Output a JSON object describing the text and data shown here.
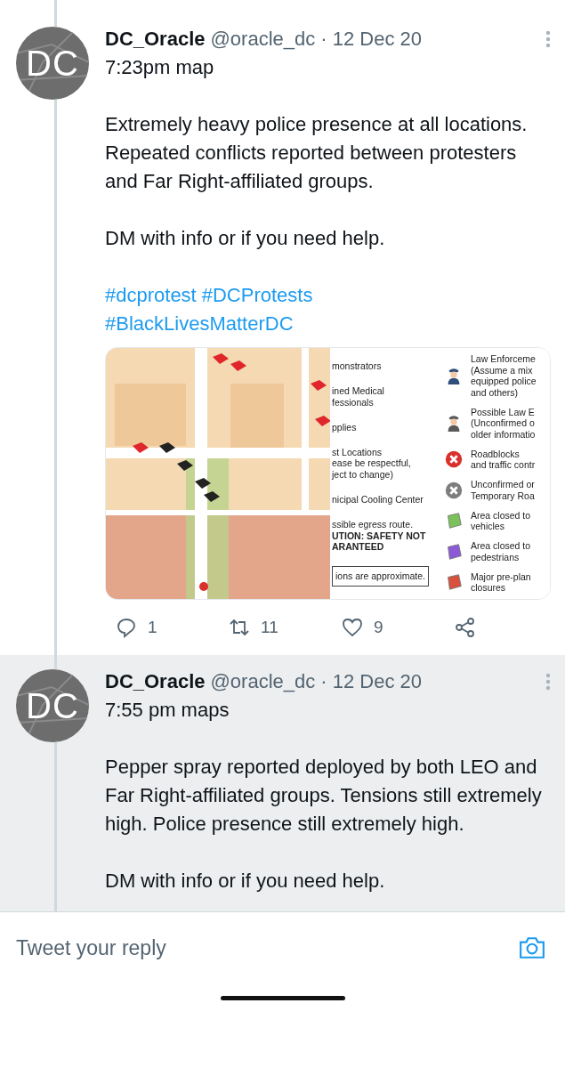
{
  "tweets": [
    {
      "highlighted": false,
      "avatar": "DC",
      "name": "DC_Oracle",
      "handle": "@oracle_dc",
      "date": "· 12 Dec 20",
      "subtitle": "7:23pm map",
      "paragraphs": [
        "Extremely heavy police presence at all locations. Repeated conflicts reported between protesters and Far Right-affiliated groups.",
        "DM with info or if you need help."
      ],
      "hashtags": [
        "#dcprotest",
        "#DCProtests",
        "#BlackLivesMatterDC"
      ],
      "media": {
        "kind": "picture",
        "legend_left": [
          {
            "kind": "plain",
            "text": "monstrators"
          },
          {
            "kind": "plain",
            "text": "ined Medical\nfessionals"
          },
          {
            "kind": "plain",
            "text": "pplies"
          },
          {
            "kind": "plain",
            "text": "st Locations\nease be respectful,\nject to change)"
          },
          {
            "kind": "plain",
            "text": "nicipal Cooling Center"
          },
          {
            "kind": "plain",
            "text": "ssible egress route.\n**UTION: SAFETY NOT\nARANTEED**"
          },
          {
            "kind": "boxed",
            "text": "ions are approximate."
          }
        ],
        "legend_right": [
          {
            "kind": "officer",
            "color": "#2f4f78",
            "text": "Law Enforceme\n(Assume a mix\nequipped police\nand others)"
          },
          {
            "kind": "officer",
            "color": "#5a5a5a",
            "text": "Possible Law E\n(Unconfirmed o\nolder informatio"
          },
          {
            "kind": "cross",
            "color": "#d9302c",
            "text": "Roadblocks\nand traffic contr"
          },
          {
            "kind": "cross",
            "color": "#7d7d7d",
            "text": "Unconfirmed or\nTemporary Roa"
          },
          {
            "kind": "area",
            "color": "#7cc25a",
            "text": "Area closed to\nvehicles"
          },
          {
            "kind": "area",
            "color": "#8a5ad8",
            "text": "Area closed to\npedestrians"
          },
          {
            "kind": "area",
            "color": "#d9503c",
            "text": "Major pre-plan\nclosures"
          }
        ]
      },
      "actions": [
        {
          "kind": "reply",
          "count": "1"
        },
        {
          "kind": "retweet",
          "count": "11"
        },
        {
          "kind": "like",
          "count": "9"
        },
        {
          "kind": "share"
        }
      ]
    },
    {
      "highlighted": true,
      "avatar": "DC",
      "name": "DC_Oracle",
      "handle": "@oracle_dc",
      "date": "· 12 Dec 20",
      "subtitle": "7:55 pm maps",
      "paragraphs": [
        "Pepper spray reported deployed by both LEO and Far Right-affiliated groups. Tensions still extremely high. Police presence still extremely high.",
        "DM with info or if you need help."
      ]
    }
  ],
  "reply": {
    "placeholder": "Tweet your reply"
  }
}
